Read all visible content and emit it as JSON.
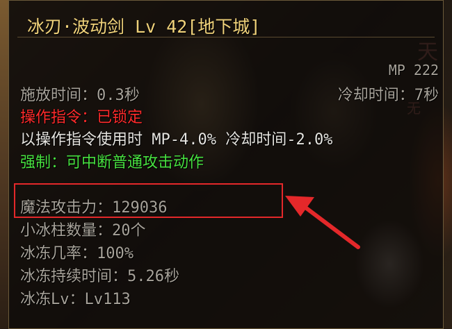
{
  "tooltip": {
    "title": "冰刃·波动剑 Lv 42[地下城]",
    "mp_cost": "MP 222",
    "cast_time": "施放时间：0.3秒",
    "cooldown": "冷却时间：7秒",
    "command": {
      "label": "操作指令",
      "separator": "：",
      "value": "已锁定"
    },
    "command_bonus": "以操作指令使用时 MP-4.0% 冷却时间-2.0%",
    "force": {
      "label": "强制",
      "separator": "：",
      "value": "可中断普通攻击动作"
    },
    "stats": [
      "魔法攻击力：129036",
      "小冰柱数量：20个",
      "冰冻几率：100%",
      "冰冻持续时间：5.26秒",
      "冰冻Lv：Lv113"
    ]
  },
  "colors": {
    "title": "#f0d27a",
    "locked": "#ff2b2b",
    "force": "#48e040",
    "highlight": "#e4282a",
    "arrow": "#e4282a"
  }
}
